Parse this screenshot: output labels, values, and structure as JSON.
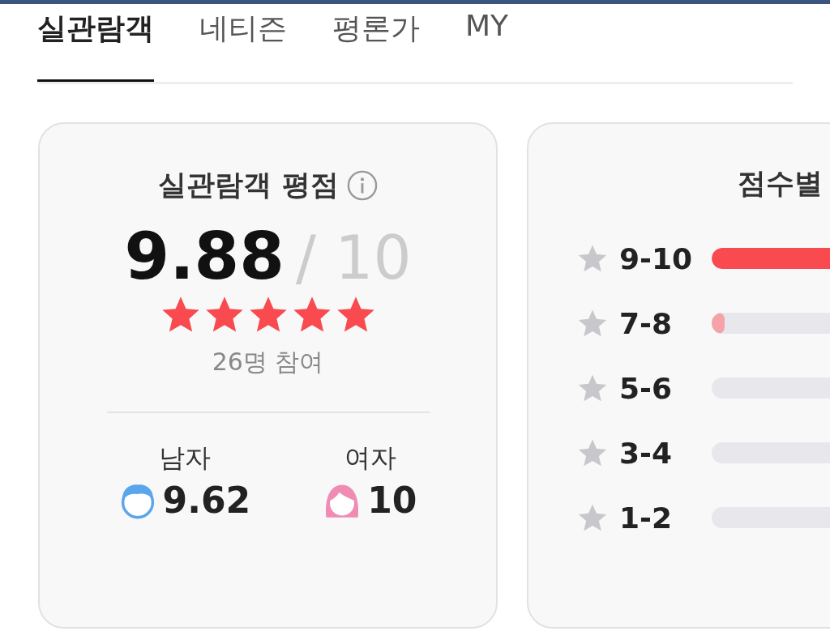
{
  "tabs": [
    {
      "label": "실관람객",
      "selected": true
    },
    {
      "label": "네티즌",
      "selected": false
    },
    {
      "label": "평론가",
      "selected": false
    },
    {
      "label": "MY",
      "selected": false
    }
  ],
  "rating_card": {
    "title": "실관람객 평점",
    "score": "9.88",
    "max": "/ 10",
    "stars": 5,
    "participants": "26명 참여",
    "genders": [
      {
        "kind": "male",
        "label": "남자",
        "score": "9.62"
      },
      {
        "kind": "female",
        "label": "여자",
        "score": "10"
      }
    ]
  },
  "distribution_card": {
    "title": "점수별",
    "rows": [
      {
        "label": "9-10",
        "level": 0.9,
        "kind": "top"
      },
      {
        "label": "7-8",
        "level": 0.04,
        "kind": "normal"
      },
      {
        "label": "5-6",
        "level": 0
      },
      {
        "label": "3-4",
        "level": 0
      },
      {
        "label": "1-2",
        "level": 0
      }
    ]
  }
}
